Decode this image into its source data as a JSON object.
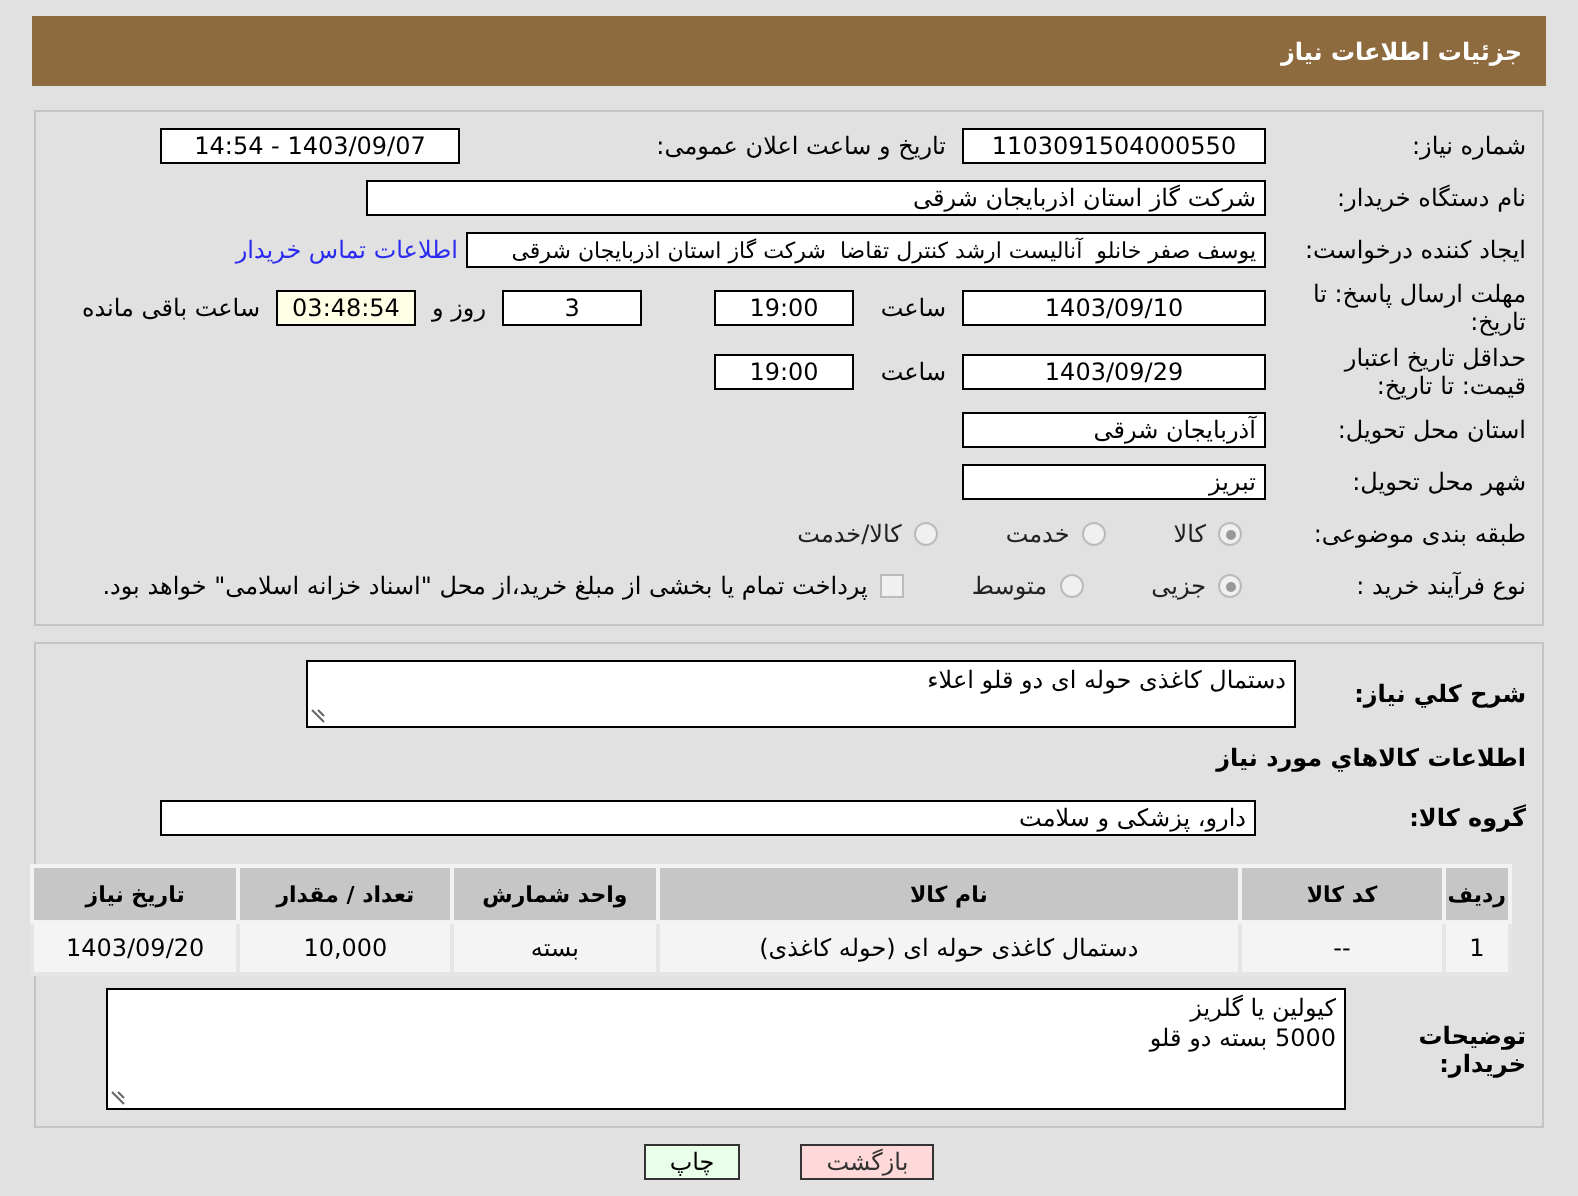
{
  "header": {
    "title": "جزئیات اطلاعات نیاز"
  },
  "need_number": {
    "label": "شماره نیاز:",
    "value": "1103091504000550"
  },
  "announce": {
    "label": "تاریخ و ساعت اعلان عمومی:",
    "value": "1403/09/07 - 14:54"
  },
  "buyer": {
    "label": "نام دستگاه خریدار:",
    "value": "شرکت گاز استان اذربایجان شرقی"
  },
  "requester": {
    "label": "ایجاد کننده درخواست:",
    "value": "یوسف صفر خانلو  آنالیست ارشد کنترل تقاضا  شرکت گاز استان اذربایجان شرقی",
    "link": "اطلاعات تماس خریدار"
  },
  "reply_deadline": {
    "label": "مهلت ارسال پاسخ: تا تاریخ:",
    "date": "1403/09/10",
    "time_label": "ساعت",
    "time": "19:00",
    "days": "3",
    "days_label": "روز و",
    "remaining": "03:48:54",
    "remaining_label": "ساعت باقی مانده"
  },
  "validity": {
    "label": "حداقل تاریخ اعتبار قیمت: تا تاریخ:",
    "date": "1403/09/29",
    "time_label": "ساعت",
    "time": "19:00"
  },
  "province": {
    "label": "استان محل تحویل:",
    "value": "آذربایجان شرقی"
  },
  "city": {
    "label": "شهر محل تحویل:",
    "value": "تبریز"
  },
  "category": {
    "label": "طبقه بندی موضوعی:",
    "options": [
      {
        "label": "کالا",
        "selected": true
      },
      {
        "label": "خدمت",
        "selected": false
      },
      {
        "label": "کالا/خدمت",
        "selected": false
      }
    ]
  },
  "process": {
    "label": "نوع فرآیند خرید :",
    "options": [
      {
        "label": "جزیی",
        "selected": true
      },
      {
        "label": "متوسط",
        "selected": false
      }
    ],
    "payment": {
      "label": "پرداخت تمام یا بخشی از مبلغ خرید،از محل \"اسناد خزانه اسلامی\" خواهد بود.",
      "checked": false
    }
  },
  "description": {
    "label": "شرح کلي نياز:",
    "value": "دستمال کاغذی حوله ای دو قلو اعلاء"
  },
  "goods_title": "اطلاعات کالاهاي مورد نياز",
  "goods_group": {
    "label": "گروه کالا:",
    "value": "دارو، پزشکی و سلامت"
  },
  "table": {
    "columns": [
      "ردیف",
      "کد کالا",
      "نام کالا",
      "واحد شمارش",
      "تعداد / مقدار",
      "تاریخ نیاز"
    ],
    "rows": [
      [
        "1",
        "--",
        "دستمال کاغذی حوله ای (حوله کاغذی)",
        "بسته",
        "10,000",
        "1403/09/20"
      ]
    ]
  },
  "notes": {
    "label": "توضیحات خریدار:",
    "lines": [
      "کیولین یا گلریز",
      "5000 بسته دو قلو"
    ]
  },
  "buttons": [
    {
      "label": "بازگشت",
      "kind": "back"
    },
    {
      "label": "چاپ",
      "kind": "print"
    }
  ]
}
